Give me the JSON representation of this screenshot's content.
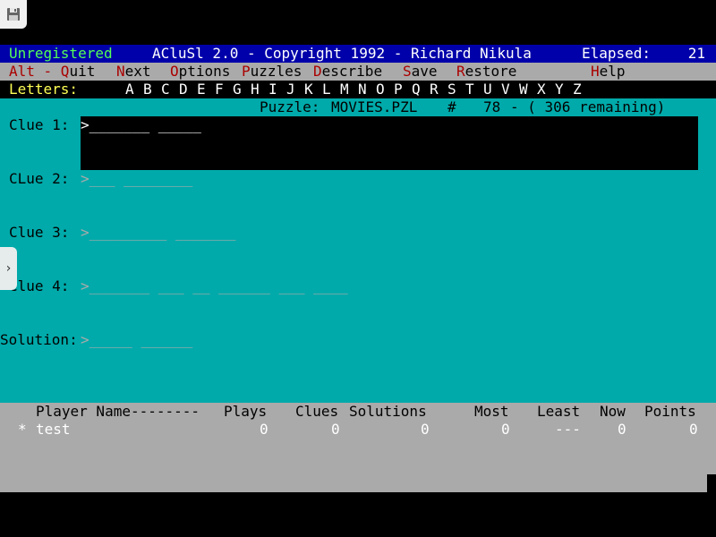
{
  "status_bar": {
    "registration": "Unregistered",
    "title": "ACluSl 2.0 - Copyright 1992 - Richard Nikula",
    "elapsed_label": "Elapsed:",
    "elapsed_value": "21"
  },
  "menu": {
    "quit": {
      "hot": "Alt - Q",
      "rest": "uit"
    },
    "next": {
      "hot": "N",
      "rest": "ext"
    },
    "options": {
      "hot": "O",
      "rest": "ptions"
    },
    "puzzles": {
      "hot": "P",
      "rest": "uzzles"
    },
    "describe": {
      "hot": "D",
      "rest": "escribe"
    },
    "save": {
      "hot": "S",
      "rest": "ave"
    },
    "restore": {
      "hot": "R",
      "rest": "estore"
    },
    "help": {
      "hot": "H",
      "rest": "elp"
    }
  },
  "letters": {
    "label": "Letters:",
    "items": [
      "A",
      "B",
      "C",
      "D",
      "E",
      "F",
      "G",
      "H",
      "I",
      "J",
      "K",
      "L",
      "M",
      "N",
      "O",
      "P",
      "Q",
      "R",
      "S",
      "T",
      "U",
      "V",
      "W",
      "X",
      "Y",
      "Z"
    ]
  },
  "puzzle_info": {
    "label": "Puzzle:",
    "file": "MOVIES.PZL",
    "hash": "#",
    "number": "78",
    "remaining": "- ( 306 remaining)"
  },
  "clues": [
    {
      "label": "Clue 1:",
      "pattern": "_______ _____"
    },
    {
      "label": "CLue 2:",
      "pattern": "___ ________"
    },
    {
      "label": "Clue 3:",
      "pattern": "_________ _______"
    },
    {
      "label": "Clue 4:",
      "pattern": "_______ ___ __ ______ ___ ____"
    }
  ],
  "solution": {
    "label": "Solution:",
    "pattern": "_____ ______"
  },
  "prompt_glyph": ">",
  "scoreboard": {
    "headers": {
      "player_name": "Player Name--------",
      "plays": "Plays",
      "clues": "Clues",
      "solutions": "Solutions",
      "most": "Most",
      "least": "Least",
      "now": "Now",
      "points": "Points"
    },
    "rows": [
      {
        "marker": "*",
        "name": "test",
        "plays": "0",
        "clues": "0",
        "solutions": "0",
        "most": "0",
        "least": "---",
        "now": "0",
        "points": "0"
      }
    ]
  },
  "colors": {
    "background_main": "#00aaaa",
    "status_bar": "#0000aa",
    "menu_bar": "#aaaaaa",
    "hotkey": "#aa0000",
    "letters_label": "#ffff55",
    "registration": "#55ff55"
  },
  "icons": {
    "save_disk": "floppy-disk-icon",
    "side_panel": "chevron-right-icon"
  }
}
